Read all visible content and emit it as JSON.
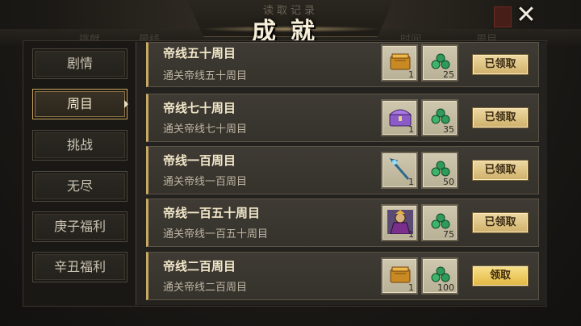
{
  "header": {
    "title": "成就",
    "subtitle": "读取记录",
    "ghost_left": "挑衅",
    "ghost_mid": "带线",
    "ghost_r1": "时间",
    "ghost_r2": "周目"
  },
  "tabs": [
    {
      "label": "剧情",
      "active": false
    },
    {
      "label": "周目",
      "active": true
    },
    {
      "label": "挑战",
      "active": false
    },
    {
      "label": "无尽",
      "active": false
    },
    {
      "label": "庚子福利",
      "active": false
    },
    {
      "label": "辛丑福利",
      "active": false
    }
  ],
  "achievements": [
    {
      "title": "帝线五十周目",
      "desc": "通关帝线五十周目",
      "item_icon": "gold-book-icon",
      "item_qty": "1",
      "jade_icon": "jade-coin-icon",
      "jade_qty": "25",
      "button": "已领取",
      "claimed": true
    },
    {
      "title": "帝线七十周目",
      "desc": "通关帝线七十周目",
      "item_icon": "purple-chest-icon",
      "item_qty": "1",
      "jade_icon": "jade-coin-icon",
      "jade_qty": "35",
      "button": "已领取",
      "claimed": true
    },
    {
      "title": "帝线一百周目",
      "desc": "通关帝线一百周目",
      "item_icon": "blue-staff-icon",
      "item_qty": "1",
      "jade_icon": "jade-coin-icon",
      "jade_qty": "50",
      "button": "已领取",
      "claimed": true
    },
    {
      "title": "帝线一百五十周目",
      "desc": "通关帝线一百五十周目",
      "item_icon": "hero-portrait-icon",
      "item_qty": "1",
      "jade_icon": "jade-coin-icon",
      "jade_qty": "75",
      "button": "已领取",
      "claimed": true
    },
    {
      "title": "帝线二百周目",
      "desc": "通关帝线二百周目",
      "item_icon": "gold-book-icon",
      "item_qty": "1",
      "jade_icon": "jade-coin-icon",
      "jade_qty": "100",
      "button": "领取",
      "claimed": false
    }
  ],
  "colors": {
    "accent": "#c8aa62",
    "button_ready": "#e2b742",
    "jade": "#2f9a5a"
  }
}
